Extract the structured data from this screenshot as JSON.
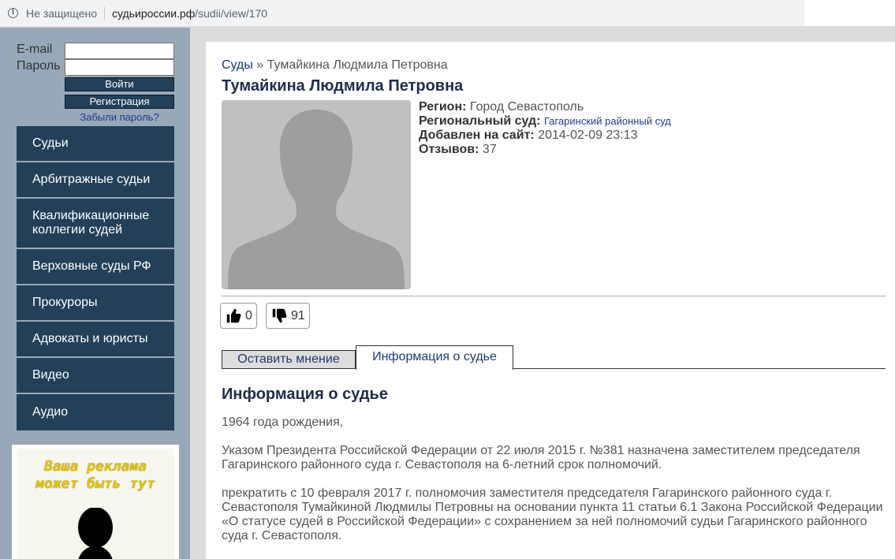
{
  "browser": {
    "security_text": "Не защищено",
    "url_host": "судьироссии.рф",
    "url_path": "/sudii/view/170"
  },
  "login": {
    "email_label": "E-mail",
    "password_label": "Пароль",
    "login_button": "Войти",
    "register_button": "Регистрация",
    "forgot_link": "Забыли пароль?"
  },
  "nav": {
    "items": [
      {
        "label": "Судьи"
      },
      {
        "label": "Арбитражные судьи"
      },
      {
        "label": "Квалификационные коллегии судей"
      },
      {
        "label": "Верховные суды РФ"
      },
      {
        "label": "Прокуроры"
      },
      {
        "label": "Адвокаты и юристы"
      },
      {
        "label": "Видео"
      },
      {
        "label": "Аудио"
      }
    ]
  },
  "ad": {
    "line1": "Ваша реклама",
    "line2": "может быть тут"
  },
  "breadcrumb": {
    "root": "Суды",
    "separator": "»",
    "current": "Тумайкина Людмила Петровна"
  },
  "judge": {
    "name": "Тумайкина Людмила Петровна",
    "region_label": "Регион:",
    "region": "Город Севастополь",
    "court_label": "Региональный суд:",
    "court": "Гагаринский районный суд",
    "added_label": "Добавлен на сайт:",
    "added": "2014-02-09 23:13",
    "reviews_label": "Отзывов:",
    "reviews": "37"
  },
  "votes": {
    "likes": "0",
    "dislikes": "91"
  },
  "tabs": {
    "opinion": "Оставить мнение",
    "info": "Информация о судье"
  },
  "info": {
    "title": "Информация о судье",
    "p1": "1964 года рождения,",
    "p2": "Указом Президента Российской Федерации от 22 июля 2015 г. №381 назначена заместителем председателя Гагаринского районного суда г. Севастополя на 6-летний срок полномочий.",
    "p3": "прекратить с 10 февраля 2017 г. полномочия заместителя председателя Гагаринского районного суда г. Севастополя Тумайкиной Людмилы Петровны на основании пункта 11 статьи 6.1 Закона Российской Федерации «О статусе судей в Российской Федерации» с сохранением за ней полномочий судьи Гагаринского районного суда г. Севастополя."
  },
  "colors": {
    "nav_bg": "#234058",
    "sidebar_bg": "#98a8b8",
    "heading": "#1f2d4a",
    "link": "#1f3a8a"
  }
}
